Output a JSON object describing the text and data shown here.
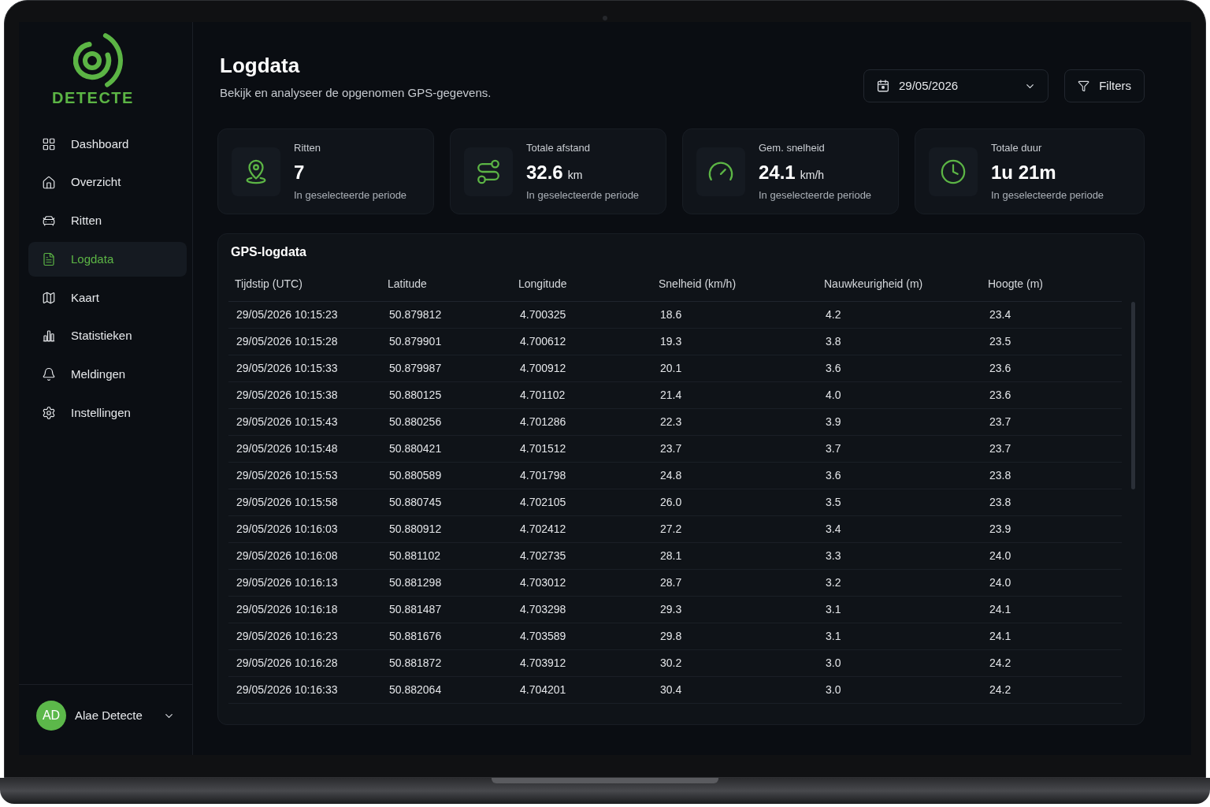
{
  "sidebar": {
    "logo_text": "DETECTE",
    "items": [
      {
        "label": "Dashboard",
        "selected": false
      },
      {
        "label": "Overzicht",
        "selected": false
      },
      {
        "label": "Ritten",
        "selected": false
      },
      {
        "label": "Logdata",
        "selected": true
      },
      {
        "label": "Kaart",
        "selected": false
      },
      {
        "label": "Statistieken",
        "selected": false
      },
      {
        "label": "Meldingen",
        "selected": false
      },
      {
        "label": "Instellingen",
        "selected": false
      }
    ],
    "user": {
      "initials": "AD",
      "name": "Alae Detecte"
    }
  },
  "header": {
    "title": "Logdata",
    "subtitle": "Bekijk en analyseer de opgenomen GPS-gegevens.",
    "date_picker": {
      "value": "29/05/2026"
    },
    "filters_button": {
      "label": "Filters"
    }
  },
  "stats": [
    {
      "label": "Ritten",
      "value": "7",
      "sub": "In geselecteerde periode"
    },
    {
      "label": "Totale afstand",
      "value": "32.6",
      "unit": "km",
      "sub": "In geselecteerde periode"
    },
    {
      "label": "Gem. snelheid",
      "value": "24.1",
      "unit": "km/h",
      "sub": "In geselecteerde periode"
    },
    {
      "label": "Totale duur",
      "value": "1u 21m",
      "sub": "In geselecteerde periode"
    }
  ],
  "table": {
    "title": "GPS-logdata",
    "columns": [
      "Tijdstip (UTC)",
      "Latitude",
      "Longitude",
      "Snelheid (km/h)",
      "Nauwkeurigheid (m)",
      "Hoogte (m)"
    ],
    "rows": [
      [
        "29/05/2026 10:15:23",
        "50.879812",
        "4.700325",
        "18.6",
        "4.2",
        "23.4"
      ],
      [
        "29/05/2026 10:15:28",
        "50.879901",
        "4.700612",
        "19.3",
        "3.8",
        "23.5"
      ],
      [
        "29/05/2026 10:15:33",
        "50.879987",
        "4.700912",
        "20.1",
        "3.6",
        "23.6"
      ],
      [
        "29/05/2026 10:15:38",
        "50.880125",
        "4.701102",
        "21.4",
        "4.0",
        "23.6"
      ],
      [
        "29/05/2026 10:15:43",
        "50.880256",
        "4.701286",
        "22.3",
        "3.9",
        "23.7"
      ],
      [
        "29/05/2026 10:15:48",
        "50.880421",
        "4.701512",
        "23.7",
        "3.7",
        "23.7"
      ],
      [
        "29/05/2026 10:15:53",
        "50.880589",
        "4.701798",
        "24.8",
        "3.6",
        "23.8"
      ],
      [
        "29/05/2026 10:15:58",
        "50.880745",
        "4.702105",
        "26.0",
        "3.5",
        "23.8"
      ],
      [
        "29/05/2026 10:16:03",
        "50.880912",
        "4.702412",
        "27.2",
        "3.4",
        "23.9"
      ],
      [
        "29/05/2026 10:16:08",
        "50.881102",
        "4.702735",
        "28.1",
        "3.3",
        "24.0"
      ],
      [
        "29/05/2026 10:16:13",
        "50.881298",
        "4.703012",
        "28.7",
        "3.2",
        "24.0"
      ],
      [
        "29/05/2026 10:16:18",
        "50.881487",
        "4.703298",
        "29.3",
        "3.1",
        "24.1"
      ],
      [
        "29/05/2026 10:16:23",
        "50.881676",
        "4.703589",
        "29.8",
        "3.1",
        "24.1"
      ],
      [
        "29/05/2026 10:16:28",
        "50.881872",
        "4.703912",
        "30.2",
        "3.0",
        "24.2"
      ],
      [
        "29/05/2026 10:16:33",
        "50.882064",
        "4.704201",
        "30.4",
        "3.0",
        "24.2"
      ]
    ]
  }
}
